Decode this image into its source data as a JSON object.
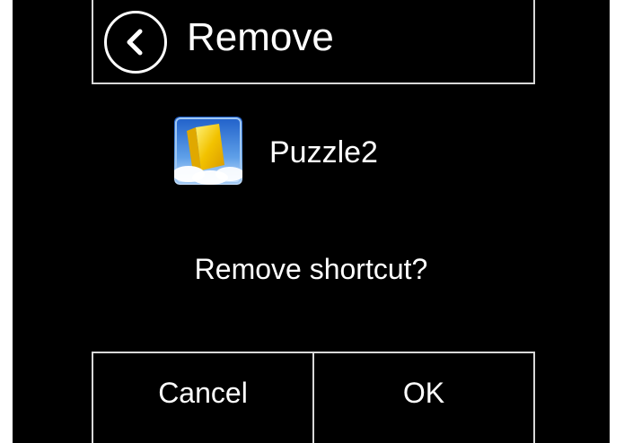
{
  "header": {
    "back_icon": "chevron-left-icon",
    "title": "Remove"
  },
  "app": {
    "icon": "puzzle-app-icon",
    "name": "Puzzle2"
  },
  "prompt": "Remove shortcut?",
  "actions": {
    "cancel_label": "Cancel",
    "ok_label": "OK"
  },
  "colors": {
    "background": "#000000",
    "text": "#ffffff",
    "border": "#d8d8d8"
  }
}
